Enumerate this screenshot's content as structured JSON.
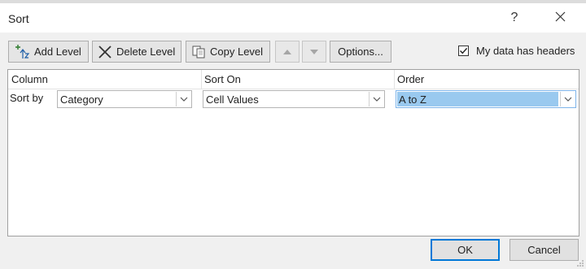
{
  "window": {
    "title": "Sort",
    "help_label": "?"
  },
  "toolbar": {
    "add_level": "Add Level",
    "delete_level": "Delete Level",
    "copy_level": "Copy Level",
    "options": "Options...",
    "headers_checkbox": {
      "label": "My data has headers",
      "checked": true
    }
  },
  "grid": {
    "headers": [
      "Column",
      "Sort On",
      "Order"
    ],
    "rows": [
      {
        "label": "Sort by",
        "column": "Category",
        "sort_on": "Cell Values",
        "order": "A to Z"
      }
    ]
  },
  "footer": {
    "ok": "OK",
    "cancel": "Cancel"
  },
  "colors": {
    "accent": "#0078d7",
    "selection": "#99c9ef"
  }
}
